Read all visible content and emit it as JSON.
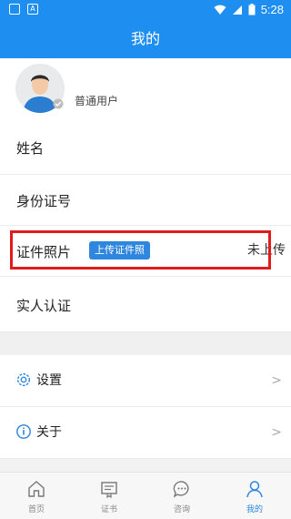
{
  "status_bar": {
    "time": "5:28",
    "left_icons": [
      "notification-square-icon",
      "app-a-icon"
    ],
    "right_icons": [
      "wifi-icon",
      "signal-icon",
      "battery-icon"
    ]
  },
  "header": {
    "title": "我的"
  },
  "profile": {
    "username": "普通用户"
  },
  "rows": {
    "name": "姓名",
    "id_number": "身份证号",
    "id_photo": "证件照片",
    "upload_button": "上传证件照",
    "upload_status": "未上传",
    "verify": "实人认证"
  },
  "settings": {
    "label": "设置",
    "icon": "gear-icon"
  },
  "about": {
    "label": "关于",
    "icon": "info-icon"
  },
  "tabs": [
    {
      "label": "首页",
      "icon": "home-icon"
    },
    {
      "label": "证书",
      "icon": "certificate-icon"
    },
    {
      "label": "咨询",
      "icon": "chat-icon"
    },
    {
      "label": "我的",
      "icon": "user-icon",
      "active": true
    }
  ],
  "colors": {
    "primary": "#1e8ef0",
    "badge": "#2f86de",
    "highlight": "#e21b1b",
    "active_tab": "#2f86de"
  }
}
